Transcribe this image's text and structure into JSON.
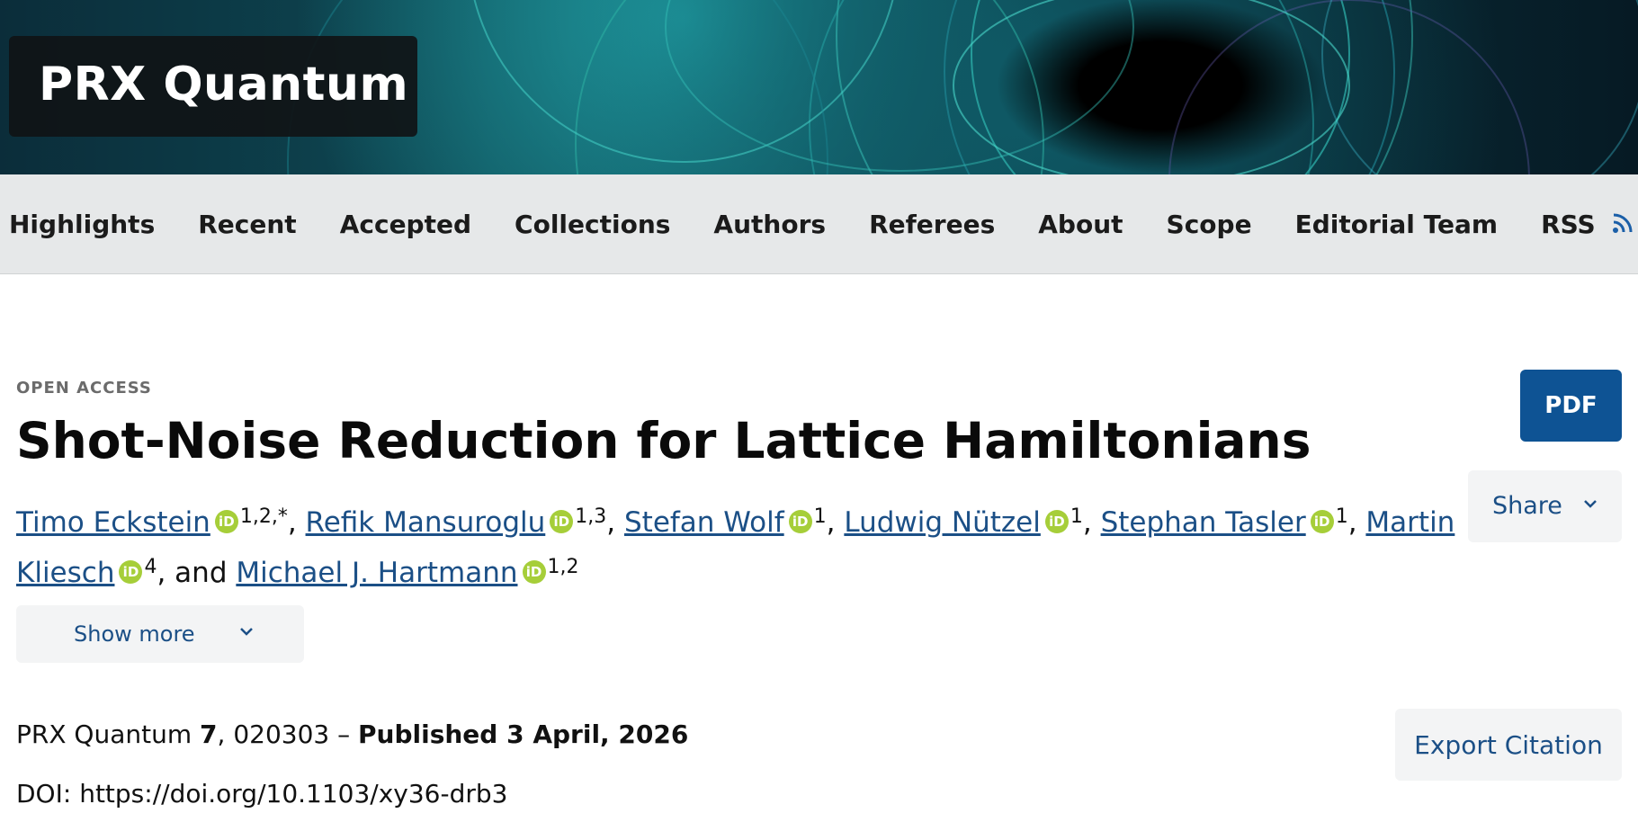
{
  "header": {
    "journal": "PRX Quantum"
  },
  "nav": {
    "items": [
      "Highlights",
      "Recent",
      "Accepted",
      "Collections",
      "Authors",
      "Referees",
      "About",
      "Scope",
      "Editorial Team",
      "RSS"
    ]
  },
  "article": {
    "access": "OPEN ACCESS",
    "title": "Shot-Noise Reduction for Lattice Hamiltonians",
    "authors": [
      {
        "name": "Timo Eckstein",
        "aff": "1,2,*"
      },
      {
        "name": "Refik Mansuroglu",
        "aff": "1,3"
      },
      {
        "name": "Stefan Wolf",
        "aff": "1"
      },
      {
        "name": "Ludwig Nützel",
        "aff": "1"
      },
      {
        "name": "Stephan Tasler",
        "aff": "1"
      },
      {
        "name": "Martin Kliesch",
        "aff": "4"
      },
      {
        "name": "Michael J. Hartmann",
        "aff": "1,2"
      }
    ],
    "orcid_label": "iD",
    "and_text": ", and",
    "show_more": "Show more",
    "journal": "PRX Quantum",
    "volume": "7",
    "article_number": ", 020303 – ",
    "published": "Published 3 April, 2026",
    "doi_label": "DOI: ",
    "doi": "https://doi.org/10.1103/xy36-drb3"
  },
  "actions": {
    "pdf": "PDF",
    "share": "Share",
    "export": "Export Citation"
  },
  "colors": {
    "link": "#1b4f86",
    "pdf_bg": "#0e5394",
    "orcid": "#a6ce39"
  }
}
